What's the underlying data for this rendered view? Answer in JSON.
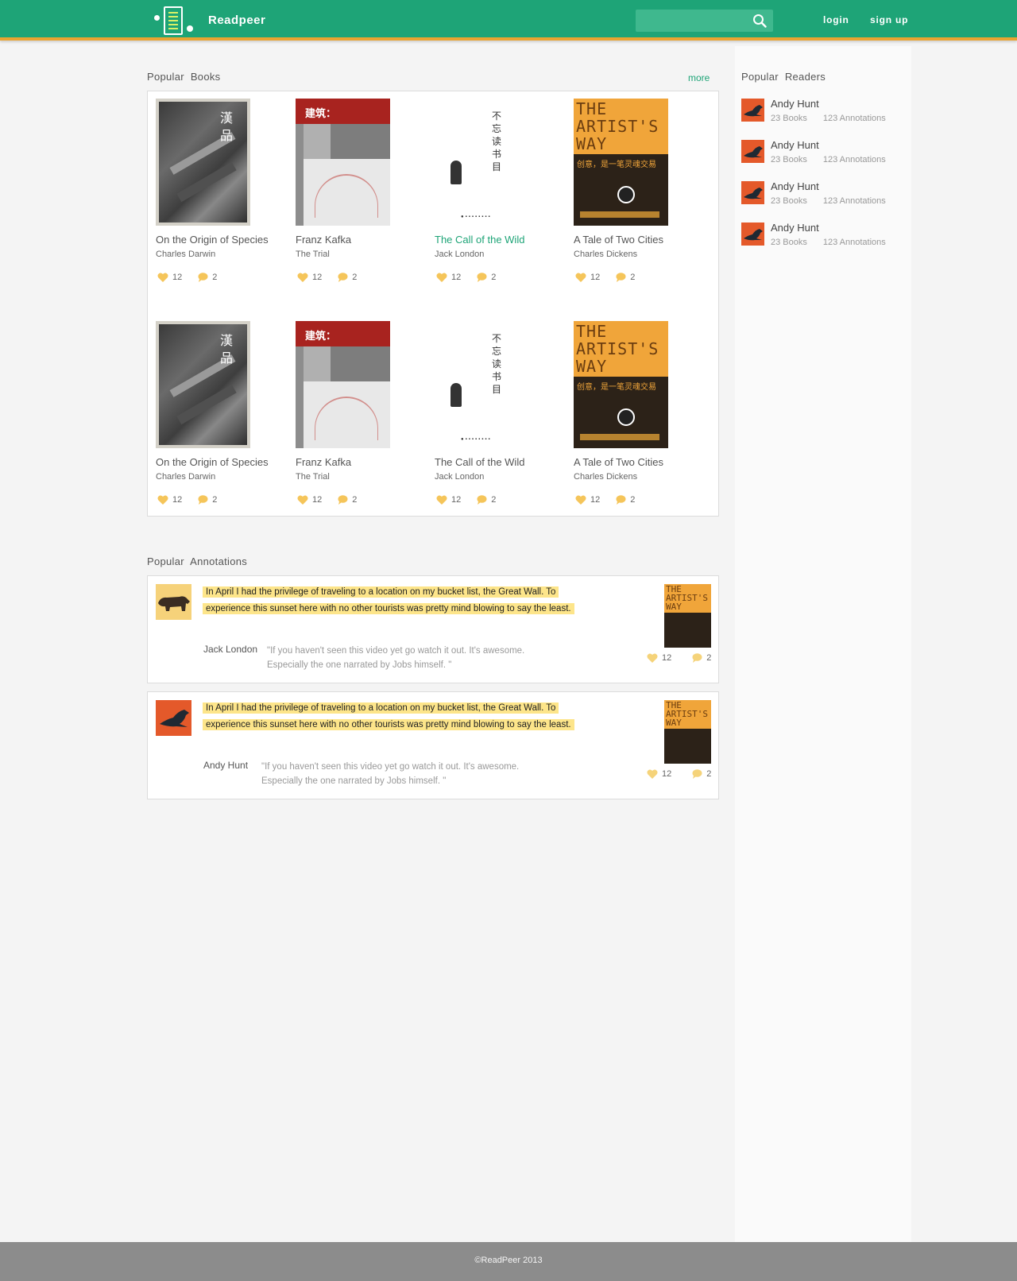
{
  "header": {
    "brand": "Readpeer",
    "search": {
      "value": "",
      "placeholder": ""
    },
    "login_label": "login",
    "signup_label": "sign up"
  },
  "colors": {
    "brand_green": "#1ea477",
    "accent_orange": "#e9a431",
    "highlight_yellow": "#fde58a",
    "icon_yellow": "#f5c55a"
  },
  "popular_books": {
    "title": "Popular  Books",
    "more_label": "more",
    "books": [
      {
        "title": "On the Origin of Species",
        "author": "Charles Darwin",
        "likes": "12",
        "comments": "2",
        "cover": "hanpin"
      },
      {
        "title": "Franz Kafka",
        "author": "The Trial",
        "likes": "12",
        "comments": "2",
        "cover": "architecture"
      },
      {
        "title": "The Call of the Wild",
        "author": "Jack London",
        "likes": "12",
        "comments": "2",
        "cover": "bushuo"
      },
      {
        "title": "A Tale of Two Cities",
        "author": "Charles Dickens",
        "likes": "12",
        "comments": "2",
        "cover": "artists-way"
      },
      {
        "title": "On the Origin of Species",
        "author": "Charles Darwin",
        "likes": "12",
        "comments": "2",
        "cover": "hanpin"
      },
      {
        "title": "Franz Kafka",
        "author": "The Trial",
        "likes": "12",
        "comments": "2",
        "cover": "architecture"
      },
      {
        "title": "The Call of the Wild",
        "author": "Jack London",
        "likes": "12",
        "comments": "2",
        "cover": "bushuo"
      },
      {
        "title": "A Tale of Two Cities",
        "author": "Charles Dickens",
        "likes": "12",
        "comments": "2",
        "cover": "artists-way"
      }
    ],
    "cover_text": {
      "hanpin": "漢品",
      "hanpin_num": "01",
      "architecture": "建筑：",
      "bushuo": "不忘读书目",
      "artists_way": "THE ARTIST'S WAY",
      "artists_way_cn": "创意，是一笔灵魂交易"
    }
  },
  "popular_annotations": {
    "title": "Popular  Annotations",
    "items": [
      {
        "quote": "In April I had the privilege of traveling to a location on my bucket list, the Great Wall. To experience this sunset here with no other tourists was pretty mind blowing to say the least.",
        "user": "Jack London",
        "comment": "\"If you haven't seen this video yet go watch it out. It's awesome. Especially the one narrated by Jobs himself. \"",
        "likes": "12",
        "comments": "2",
        "avatar": "bear"
      },
      {
        "quote": "In April I had the privilege of traveling to a location on my bucket list, the Great Wall. To experience this sunset here with no other tourists was pretty mind blowing to say the least.",
        "user": "Andy Hunt",
        "comment": "\"If you haven't seen this video yet go watch it out. It's awesome. Especially the one narrated by Jobs himself. \"",
        "likes": "12",
        "comments": "2",
        "avatar": "seal"
      }
    ],
    "book_thumb_text": "THE ARTIST'S WAY"
  },
  "popular_readers": {
    "title": "Popular  Readers",
    "readers": [
      {
        "name": "Andy Hunt",
        "books": "23 Books",
        "annotations": "123 Annotations"
      },
      {
        "name": "Andy Hunt",
        "books": "23 Books",
        "annotations": "123 Annotations"
      },
      {
        "name": "Andy Hunt",
        "books": "23 Books",
        "annotations": "123 Annotations"
      },
      {
        "name": "Andy Hunt",
        "books": "23 Books",
        "annotations": "123 Annotations"
      }
    ]
  },
  "footer": {
    "copyright": "©ReadPeer 2013"
  },
  "icons": {
    "logo": "readpeer-logo-icon",
    "search": "search-icon",
    "like": "heart-icon",
    "comment": "comment-bubble-icon"
  }
}
